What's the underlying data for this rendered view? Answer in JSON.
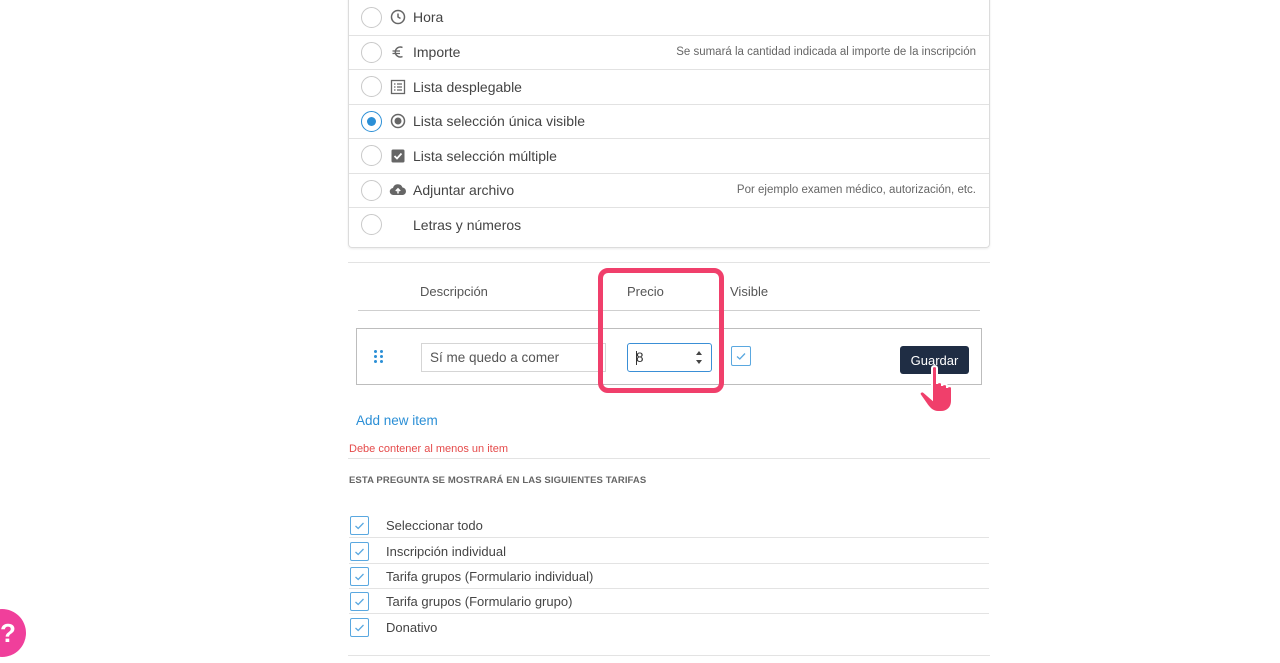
{
  "field_types": [
    {
      "label": "Hora",
      "icon": "clock-icon",
      "hint": "",
      "selected": false
    },
    {
      "label": "Importe",
      "icon": "euro-icon",
      "hint": "Se sumará la cantidad indicada al importe de la inscripción",
      "selected": false
    },
    {
      "label": "Lista desplegable",
      "icon": "list-icon",
      "hint": "",
      "selected": false
    },
    {
      "label": "Lista selección única visible",
      "icon": "radio-icon",
      "hint": "",
      "selected": true
    },
    {
      "label": "Lista selección múltiple",
      "icon": "checkbox-icon",
      "hint": "",
      "selected": false
    },
    {
      "label": "Adjuntar archivo",
      "icon": "cloud-upload-icon",
      "hint": "Por ejemplo examen médico, autorización, etc.",
      "selected": false
    },
    {
      "label": "Letras y números",
      "icon": "",
      "hint": "",
      "selected": false
    }
  ],
  "items_table": {
    "headers": {
      "description": "Descripción",
      "price": "Precio",
      "visible": "Visible"
    },
    "row": {
      "description": "Sí me quedo a comer",
      "price": "8",
      "visible": true
    },
    "save_label": "Guardar"
  },
  "add_item_label": "Add new item",
  "error_message": "Debe contener al menos un item",
  "tarifas": {
    "title": "ESTA PREGUNTA SE MOSTRARÁ EN LAS SIGUIENTES TARIFAS",
    "items": [
      {
        "label": "Seleccionar todo",
        "checked": true
      },
      {
        "label": "Inscripción individual",
        "checked": true
      },
      {
        "label": "Tarifa grupos (Formulario individual)",
        "checked": true
      },
      {
        "label": "Tarifa grupos (Formulario grupo)",
        "checked": true
      },
      {
        "label": "Donativo",
        "checked": true
      }
    ]
  },
  "help_button": "?",
  "colors": {
    "accent": "#2b8fd6",
    "highlight": "#f03f6b",
    "save_button": "#1f2d44",
    "error": "#e54b4b",
    "help": "#f03f9b"
  }
}
